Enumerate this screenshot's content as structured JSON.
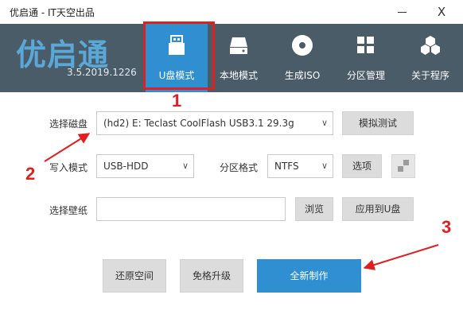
{
  "window": {
    "title": "优启通 - IT天空出品",
    "minimize_icon": "minimize-icon",
    "close_glyph": "X"
  },
  "header": {
    "logo": "优启通",
    "version": "3.5.2019.1226",
    "tabs": [
      {
        "label": "U盘模式",
        "icon": "usb-drive-icon",
        "active": true
      },
      {
        "label": "本地模式",
        "icon": "hard-disk-icon",
        "active": false
      },
      {
        "label": "生成ISO",
        "icon": "disc-icon",
        "active": false
      },
      {
        "label": "分区管理",
        "icon": "partition-grid-icon",
        "active": false
      },
      {
        "label": "关于程序",
        "icon": "cubes-icon",
        "active": false
      }
    ]
  },
  "form": {
    "disk_label": "选择磁盘",
    "disk_value": "(hd2) E: Teclast CoolFlash USB3.1 29.3g",
    "simulate_button": "模拟测试",
    "write_mode_label": "写入模式",
    "write_mode_value": "USB-HDD",
    "partition_format_label": "分区格式",
    "partition_format_value": "NTFS",
    "options_button": "选项",
    "wallpaper_label": "选择壁纸",
    "wallpaper_value": "",
    "browse_button": "浏览",
    "apply_button": "应用到U盘"
  },
  "actions": {
    "restore_button": "还原空间",
    "upgrade_button": "免格升级",
    "create_button": "全新制作"
  },
  "annotations": {
    "marker_1": "1",
    "marker_2": "2",
    "marker_3": "3"
  },
  "colors": {
    "header_bg": "#4b5c69",
    "accent": "#2f8fd0",
    "annotation_red": "#e02020"
  }
}
